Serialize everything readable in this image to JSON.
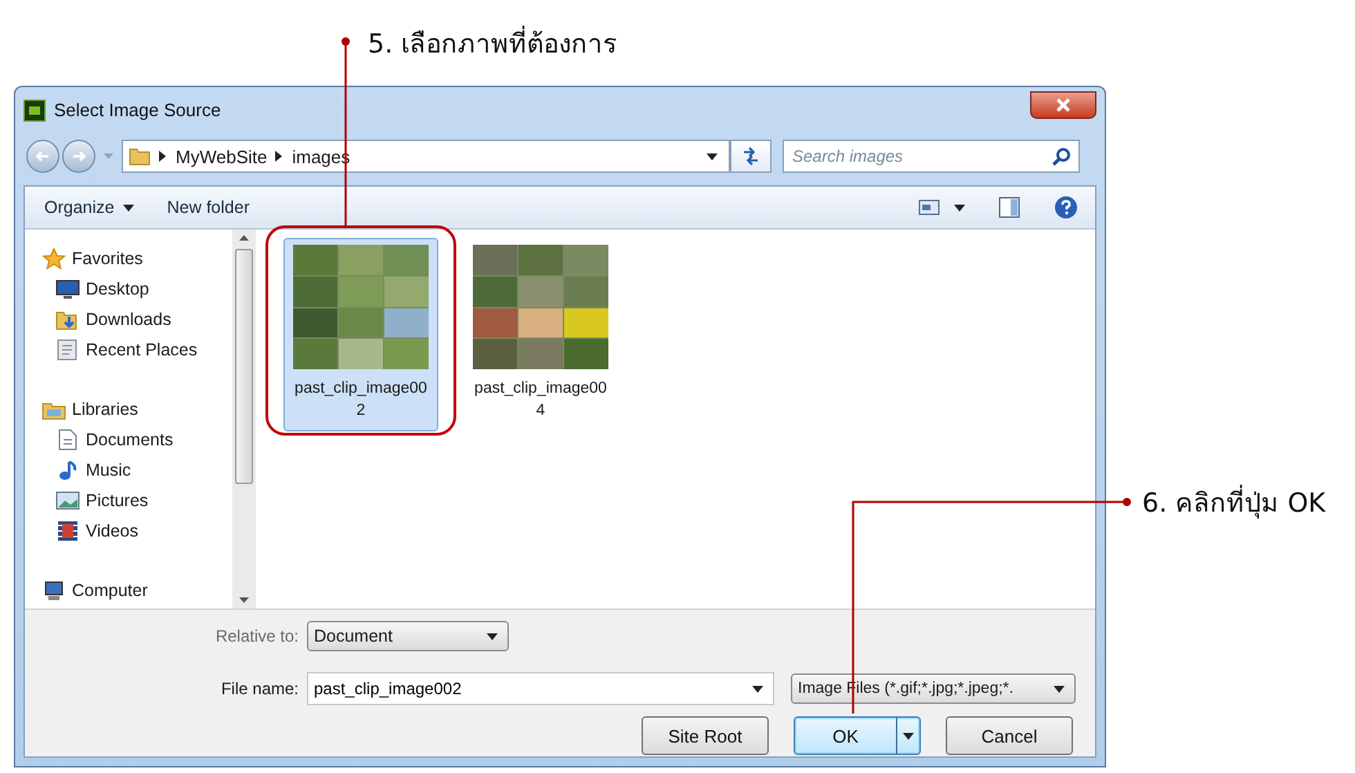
{
  "annotations": [
    {
      "text": "5. เลือกภาพที่ต้องการ"
    },
    {
      "text": "6. คลิกที่ปุ่ม OK"
    }
  ],
  "window": {
    "title": "Select Image Source"
  },
  "address": {
    "path": [
      "MyWebSite",
      "images"
    ],
    "search_placeholder": "Search images"
  },
  "toolbar": {
    "items": [
      {
        "label": "Organize",
        "kind": "menu"
      },
      {
        "label": "New folder",
        "kind": "plain"
      }
    ]
  },
  "sidebar": {
    "groups": [
      {
        "label": "Favorites",
        "children": [
          {
            "label": "Desktop"
          },
          {
            "label": "Downloads"
          },
          {
            "label": "Recent Places"
          }
        ]
      },
      {
        "label": "Libraries",
        "children": [
          {
            "label": "Documents"
          },
          {
            "label": "Music"
          },
          {
            "label": "Pictures"
          },
          {
            "label": "Videos"
          }
        ]
      },
      {
        "label": "Computer"
      }
    ]
  },
  "files": [
    {
      "name": "past_clip_image002",
      "selected": true
    },
    {
      "name": "past_clip_image004",
      "selected": false
    }
  ],
  "relative_to": {
    "label": "Relative to:",
    "value": "Document"
  },
  "file_name": {
    "label": "File name:",
    "value": "past_clip_image002"
  },
  "file_type": {
    "value": "Image Files (*.gif;*.jpg;*.jpeg;*."
  },
  "buttons": [
    {
      "label": "Site Root",
      "kind": "plain",
      "default": false
    },
    {
      "label": "OK",
      "kind": "split",
      "default": true
    },
    {
      "label": "Cancel",
      "kind": "plain",
      "default": false
    }
  ]
}
